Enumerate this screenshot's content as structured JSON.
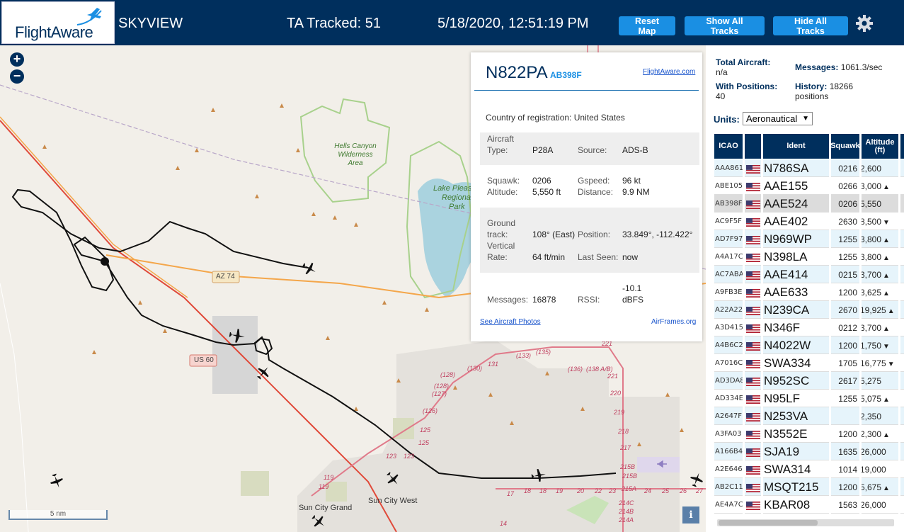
{
  "header": {
    "logo_text": "FlightAware",
    "app_title": "SKYVIEW",
    "ta_tracked": "TA Tracked: 51",
    "datetime": "5/18/2020, 12:51:19 PM",
    "reset_map": "Reset Map",
    "show_all_tracks": "Show All Tracks",
    "hide_all_tracks": "Hide All Tracks",
    "settings_icon": "gear-icon"
  },
  "map": {
    "zoom_in": "+",
    "zoom_out": "−",
    "scale_label": "5 nm",
    "info_button": "i",
    "place_labels": {
      "hells_canyon_1": "Hells Canyon",
      "hells_canyon_2": "Wilderness",
      "hells_canyon_3": "Area",
      "lake_pleasant_1": "Lake Pleas",
      "lake_pleasant_2": "Regiona",
      "lake_pleasant_3": "Park",
      "sun_city_grand": "Sun City Grand",
      "sun_city_west": "Sun City West"
    },
    "road_labels": {
      "az74": "AZ 74",
      "us60": "US 60"
    },
    "exit_labels": [
      "(135)",
      "(133)",
      "131",
      "(130)",
      "(128)",
      "(128)",
      "(127)",
      "(126)",
      "125",
      "125",
      "123",
      "123",
      "119",
      "119",
      "221",
      "(136)",
      "(138 A/B)",
      "221",
      "220",
      "219",
      "218",
      "217",
      "215B",
      "215B",
      "215A",
      "214C",
      "214B",
      "214A",
      "17",
      "18",
      "18",
      "19",
      "20",
      "22",
      "23",
      "24",
      "25",
      "26",
      "27",
      "14"
    ]
  },
  "popup": {
    "ident": "N822PA",
    "icao": "AB398F",
    "fa_link": "FlightAware.com",
    "country_label": "Country of registration:",
    "country_value": "United States",
    "aircraft_type_label_1": "Aircraft",
    "aircraft_type_label_2": "Type:",
    "aircraft_type": "P28A",
    "source_label": "Source:",
    "source": "ADS-B",
    "squawk_label": "Squawk:",
    "squawk": "0206",
    "gspeed_label": "Gspeed:",
    "gspeed": "96 kt",
    "altitude_label": "Altitude:",
    "altitude": "5,550 ft",
    "distance_label": "Distance:",
    "distance": "9.9 NM",
    "ground_track_label_1": "Ground",
    "ground_track_label_2": "track:",
    "ground_track": "108° (East)",
    "position_label": "Position:",
    "position": "33.849°, -112.422°",
    "vertical_rate_label_1": "Vertical",
    "vertical_rate_label_2": "Rate:",
    "vertical_rate": "64 ft/min",
    "last_seen_label": "Last Seen:",
    "last_seen": "now",
    "messages_label": "Messages:",
    "messages": "16878",
    "rssi_label": "RSSI:",
    "rssi_1": "-10.1",
    "rssi_2": "dBFS",
    "photos_link": "See Aircraft Photos",
    "airframes_link": "AirFrames.org"
  },
  "panel": {
    "total_aircraft_label": "Total Aircraft:",
    "total_aircraft": "n/a",
    "messages_label": "Messages:",
    "messages": "1061.3/sec",
    "with_positions_label": "With Positions:",
    "with_positions": "40",
    "history_label": "History:",
    "history_value": "18266",
    "history_unit": "positions",
    "units_label": "Units:",
    "units_value": "Aeronautical",
    "columns": {
      "icao": "ICAO",
      "ident": "Ident",
      "squawk": "Squawk",
      "altitude_1": "Altitude",
      "altitude_2": "(ft)"
    },
    "rows": [
      {
        "icao": "AAA861",
        "ident": "N786SA",
        "squawk": "0216",
        "altitude": "2,600",
        "trend": ""
      },
      {
        "icao": "ABE105",
        "ident": "AAE155",
        "squawk": "0266",
        "altitude": "3,000",
        "trend": "▲"
      },
      {
        "icao": "AB398F",
        "ident": "AAE524",
        "squawk": "0206",
        "altitude": "5,550",
        "trend": ""
      },
      {
        "icao": "AC9F5F",
        "ident": "AAE402",
        "squawk": "2630",
        "altitude": "8,500",
        "trend": "▼"
      },
      {
        "icao": "AD7F97",
        "ident": "N969WP",
        "squawk": "1255",
        "altitude": "3,800",
        "trend": "▲"
      },
      {
        "icao": "A4A17C",
        "ident": "N398LA",
        "squawk": "1255",
        "altitude": "3,800",
        "trend": "▲"
      },
      {
        "icao": "AC7ABA",
        "ident": "AAE414",
        "squawk": "0215",
        "altitude": "3,700",
        "trend": "▲"
      },
      {
        "icao": "A9FB3E",
        "ident": "AAE633",
        "squawk": "1200",
        "altitude": "3,625",
        "trend": "▲"
      },
      {
        "icao": "A22A22",
        "ident": "N239CA",
        "squawk": "2670",
        "altitude": "19,925",
        "trend": "▲"
      },
      {
        "icao": "A3D415",
        "ident": "N346F",
        "squawk": "0212",
        "altitude": "3,700",
        "trend": "▲"
      },
      {
        "icao": "A4B6C2",
        "ident": "N4022W",
        "squawk": "1200",
        "altitude": "1,750",
        "trend": "▼"
      },
      {
        "icao": "A7016C",
        "ident": "SWA334",
        "squawk": "1705",
        "altitude": "16,775",
        "trend": "▼"
      },
      {
        "icao": "AD3DA8",
        "ident": "N952SC",
        "squawk": "2617",
        "altitude": "5,275",
        "trend": ""
      },
      {
        "icao": "AD334E",
        "ident": "N95LF",
        "squawk": "1255",
        "altitude": "5,075",
        "trend": "▲"
      },
      {
        "icao": "A2647F",
        "ident": "N253VA",
        "squawk": "",
        "altitude": "2,350",
        "trend": ""
      },
      {
        "icao": "A3FA03",
        "ident": "N3552E",
        "squawk": "1200",
        "altitude": "2,300",
        "trend": "▲"
      },
      {
        "icao": "A166B4",
        "ident": "SJA19",
        "squawk": "1635",
        "altitude": "26,000",
        "trend": ""
      },
      {
        "icao": "A2E646",
        "ident": "SWA314",
        "squawk": "1014",
        "altitude": "19,000",
        "trend": ""
      },
      {
        "icao": "AB2C11",
        "ident": "MSQT215",
        "squawk": "1200",
        "altitude": "5,675",
        "trend": "▲"
      },
      {
        "icao": "AE4A7C",
        "ident": "KBAR08",
        "squawk": "1563",
        "altitude": "26,000",
        "trend": ""
      }
    ],
    "selected_icao": "AB398F"
  },
  "colors": {
    "brand_navy": "#002f5d",
    "button_blue": "#1a8fe3",
    "row_highlight": "#e6f4fb",
    "row_selected": "#dcdcdc",
    "track_line": "#111111",
    "road_orange": "#f4a64a",
    "road_red": "#e04a3a",
    "park_green": "#8fc47a",
    "lake_blue": "#aad3df"
  }
}
